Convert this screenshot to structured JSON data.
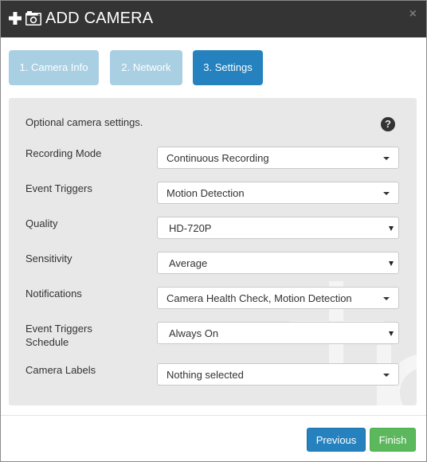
{
  "header": {
    "title": "ADD CAMERA",
    "close": "×"
  },
  "steps": [
    {
      "label": "1. Camera Info",
      "state": "inactive"
    },
    {
      "label": "2. Network",
      "state": "inactive"
    },
    {
      "label": "3. Settings",
      "state": "active"
    }
  ],
  "settings": {
    "intro": "Optional camera settings.",
    "help": "?",
    "fields": {
      "recording_mode": {
        "label": "Recording Mode",
        "value": "Continuous Recording"
      },
      "event_triggers": {
        "label": "Event Triggers",
        "value": "Motion Detection"
      },
      "quality": {
        "label": "Quality",
        "value": "HD-720P"
      },
      "sensitivity": {
        "label": "Sensitivity",
        "value": "Average"
      },
      "notifications": {
        "label": "Notifications",
        "value": "Camera Health Check, Motion Detection"
      },
      "schedule": {
        "label_line1": "Event Triggers",
        "label_line2": "Schedule",
        "value": "Always On"
      },
      "camera_labels": {
        "label": "Camera Labels",
        "value": "Nothing selected"
      }
    }
  },
  "footer": {
    "previous": "Previous",
    "finish": "Finish"
  },
  "colors": {
    "header_bg": "#343434",
    "step_active": "#2582bf",
    "step_inactive": "#a9cfe3",
    "finish": "#5cb85c",
    "panel_bg": "#e8e8e8"
  },
  "icons": {
    "plus": "plus-icon",
    "camera": "camera-icon",
    "close": "close-icon",
    "help": "question-circle-icon",
    "caret": "caret-down-icon"
  }
}
